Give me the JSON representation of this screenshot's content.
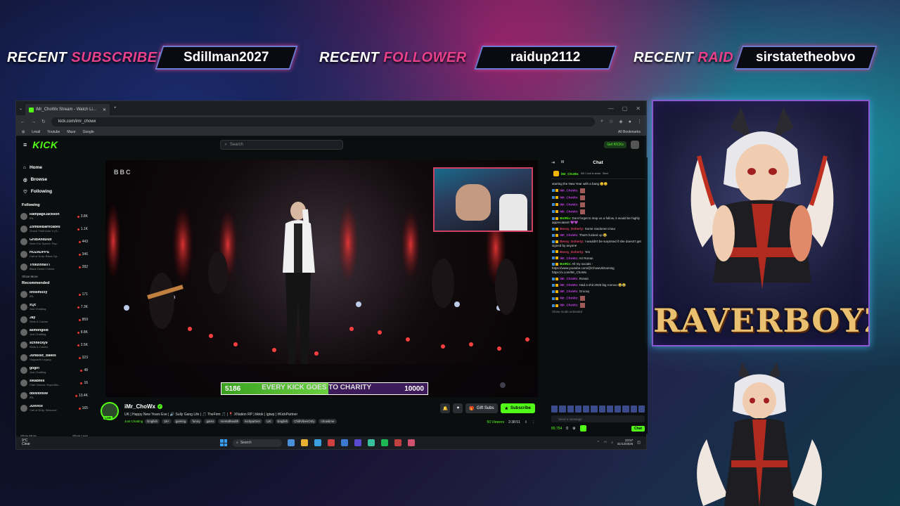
{
  "overlay": {
    "recent_subscriber": {
      "label_a": "RECENT ",
      "label_b": "SUBSCRIBER",
      "value": "Sdillman2027"
    },
    "recent_follower": {
      "label_a": "RECENT ",
      "label_b": "FOLLOWER",
      "value": "raidup2112"
    },
    "recent_raid": {
      "label_a": "RECENT ",
      "label_b": "RAID",
      "value": "sirstatetheobvo"
    },
    "art_title": "RAVERBOYZ"
  },
  "browser": {
    "tab_title": "iMr_ChoWx Stream - Watch Li...",
    "url": "kick.com/imr_chowx",
    "bookmarks": [
      "Lmail",
      "Youtube",
      "Maze",
      "Google"
    ],
    "all_bookmarks": "All Bookmarks"
  },
  "kick": {
    "logo": "KICK",
    "search_placeholder": "Search",
    "get_kicks": "Get KICKs",
    "nav": [
      {
        "label": "Home",
        "icon": "home-icon",
        "glyph": "⌂"
      },
      {
        "label": "Browse",
        "icon": "browse-icon",
        "glyph": "◎"
      },
      {
        "label": "Following",
        "icon": "heart-icon",
        "glyph": "♡"
      }
    ],
    "following_heading": "Following",
    "following": [
      {
        "name": "RampageJackson",
        "cat": "IRL",
        "viewers": "3.8K"
      },
      {
        "name": "ZombieBarricades",
        "cat": "Grand Theft Auto V (G...",
        "viewers": "1.1K"
      },
      {
        "name": "GrubAndDub",
        "cat": "Need For Speed: Pay...",
        "viewers": "443"
      },
      {
        "name": "HOZADPPS",
        "cat": "Call of Duty: Black Op...",
        "viewers": "346"
      },
      {
        "name": "TrollzinhaVT",
        "cat": "Black Desert Online",
        "viewers": "282"
      }
    ],
    "show_more": "Show More",
    "recommended_heading": "Recommended",
    "recommended": [
      {
        "name": "ilfoismizzy",
        "cat": "IRL",
        "viewers": "171"
      },
      {
        "name": "xQc",
        "cat": "Just Chatting",
        "viewers": "7.3K"
      },
      {
        "name": "Jay",
        "cat": "Slots & Casino",
        "viewers": "859"
      },
      {
        "name": "asmongold",
        "cat": "Just Chatting",
        "viewers": "8.8K"
      },
      {
        "name": "schnecky9",
        "cat": "Slots & Casino",
        "viewers": "2.5K"
      },
      {
        "name": "Jurassic_Bakes",
        "cat": "Hogwarts Legacy",
        "viewers": "323"
      },
      {
        "name": "gogirl",
        "cat": "Just Chatting",
        "viewers": "48"
      },
      {
        "name": "slkabites",
        "cat": "Clair Obscur: Expeditio...",
        "viewers": "16"
      },
      {
        "name": "oblivionsw",
        "cat": "IRL",
        "viewers": "13.4K"
      },
      {
        "name": "JDevice",
        "cat": "Call of Duty: Warzone",
        "viewers": "165"
      }
    ],
    "show_more_2": "Show More",
    "show_less": "Show Less"
  },
  "video": {
    "bbc_logo": "BBC",
    "charity": {
      "current": "5186",
      "message": "EVERY KICK GOES TO CHARITY",
      "goal": "10000",
      "progress_pct": 52
    }
  },
  "stream": {
    "streamer": "iMr_ChoWx",
    "live": "LIVE",
    "title": "UK | Happy New Years Eve | 🔊 Sully Gang Life | 🎵 TheFirm 🎵 | 📍 XNation RP | tiktok | igtwp | #KickPartner",
    "category": "Just Chatting",
    "tags": [
      "English",
      "18+",
      "gaming",
      "funny",
      "gams",
      "mentalhealth",
      "kickpartner",
      "UK",
      "English",
      "ChillVibesOnly",
      "chowtime"
    ],
    "gift_label": "Gift Subs",
    "subscribe_label": "Subscribe",
    "viewers": "50 Viewers",
    "uptime": "2:38:51"
  },
  "chat": {
    "title": "Chat",
    "mode": "M",
    "pinned": {
      "name": "iMr_ChoWx",
      "text": "Gift 1 sub to sirsta",
      "sub": "Sked"
    },
    "messages": [
      {
        "user": "",
        "color": "#dddddd",
        "text": "starting the New Year with a bang 😊😊",
        "emote": false
      },
      {
        "user": "iMr_ChoWx:",
        "color": "#c040e0",
        "text": "",
        "emote": true
      },
      {
        "user": "iMr_ChoWx:",
        "color": "#c040e0",
        "text": "",
        "emote": true
      },
      {
        "user": "iMr_ChoWx:",
        "color": "#c040e0",
        "text": "",
        "emote": true
      },
      {
        "user": "iMr_ChoWx:",
        "color": "#c040e0",
        "text": "",
        "emote": true
      },
      {
        "user": "BotRix:",
        "color": "#53fc18",
        "text": "Dont forget to stop us a follow, it would be highly appreciated! 💜💜",
        "emote": false
      },
      {
        "user": "Bessy_Doherty:",
        "color": "#e04060",
        "text": "Some randomer imao",
        "emote": false
      },
      {
        "user": "iMr_ChoWx:",
        "color": "#c040e0",
        "text": "That's fucked up 😂",
        "emote": false
      },
      {
        "user": "Bessy_Doherty:",
        "color": "#e04060",
        "text": "I wouldn't be surprised if she doesn't get signed by anyone",
        "emote": false
      },
      {
        "user": "Bessy_Doherty:",
        "color": "#e04060",
        "text": "Yes",
        "emote": false
      },
      {
        "user": "iMr_ChoWx:",
        "color": "#c040e0",
        "text": "Ari Ronan",
        "emote": false
      },
      {
        "user": "BotRix:",
        "color": "#53fc18",
        "text": "All my socials - https://www.youtube.com/@ChowUkGaming https://x.com/Mr_ChoWx",
        "emote": false
      },
      {
        "user": "iMr_ChoWx:",
        "color": "#c040e0",
        "text": "Ronan",
        "emote": false
      },
      {
        "user": "iMr_ChoWx:",
        "color": "#c040e0",
        "text": "Had a shit 2025 big ronnoo 😂😂",
        "emote": false
      },
      {
        "user": "iMr_ChoWx:",
        "color": "#c040e0",
        "text": "Groovy",
        "emote": false
      },
      {
        "user": "iMr_ChoWx:",
        "color": "#c040e0",
        "text": "",
        "emote": true
      },
      {
        "user": "iMr_ChoWx:",
        "color": "#c040e0",
        "text": "",
        "emote": true
      }
    ],
    "show_more": "Show mode activated",
    "input_placeholder": "Send a message",
    "points": "89,754",
    "count": "0",
    "send_label": "Chat"
  },
  "taskbar": {
    "weather_temp": "9°C",
    "weather_desc": "Clear",
    "search": "Search",
    "time": "23:57",
    "date": "31/12/2025",
    "apps": [
      "#4a90d9",
      "#e8b030",
      "#3aa0e0",
      "#d04040",
      "#3a7ad0",
      "#5a4ad0",
      "#3ac0a0",
      "#1db954",
      "#c04040",
      "#d05070"
    ]
  },
  "colors": {
    "kick_green": "#53fc18",
    "overlay_accent": "#e8408a",
    "charity_bar": "#4ab82a"
  }
}
